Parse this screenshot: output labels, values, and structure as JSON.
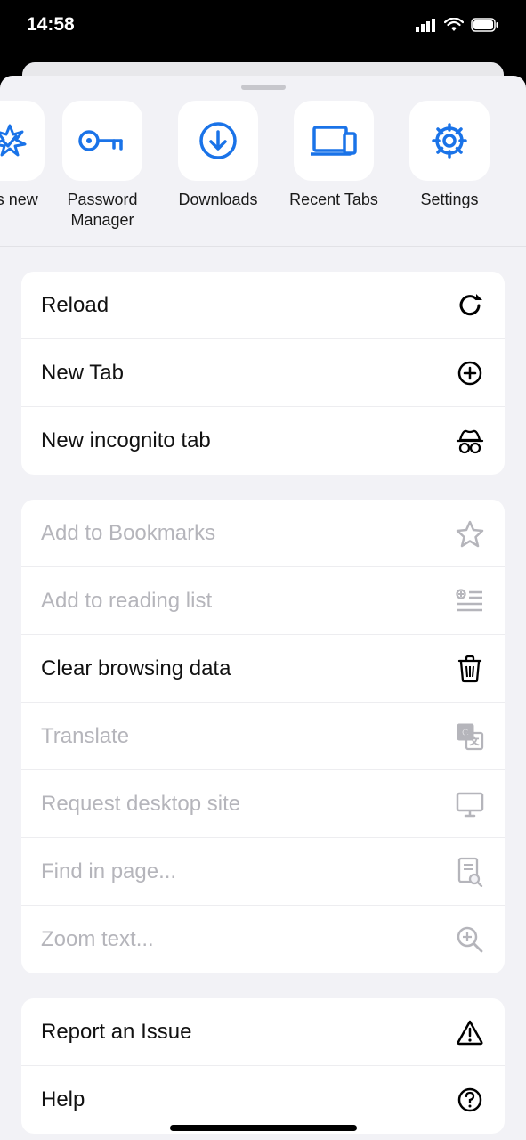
{
  "status": {
    "time": "14:58"
  },
  "shortcuts": [
    {
      "label": "t's new",
      "icon": "sparkle-badge"
    },
    {
      "label": "Password Manager",
      "icon": "key"
    },
    {
      "label": "Downloads",
      "icon": "download-circle"
    },
    {
      "label": "Recent Tabs",
      "icon": "devices"
    },
    {
      "label": "Settings",
      "icon": "gear"
    }
  ],
  "section1": [
    {
      "label": "Reload"
    },
    {
      "label": "New Tab"
    },
    {
      "label": "New incognito tab"
    }
  ],
  "section2": [
    {
      "label": "Add to Bookmarks"
    },
    {
      "label": "Add to reading list"
    },
    {
      "label": "Clear browsing data"
    },
    {
      "label": "Translate"
    },
    {
      "label": "Request desktop site"
    },
    {
      "label": "Find in page..."
    },
    {
      "label": "Zoom text..."
    }
  ],
  "section3": [
    {
      "label": "Report an Issue"
    },
    {
      "label": "Help"
    }
  ],
  "colors": {
    "accent": "#1a73e8"
  }
}
